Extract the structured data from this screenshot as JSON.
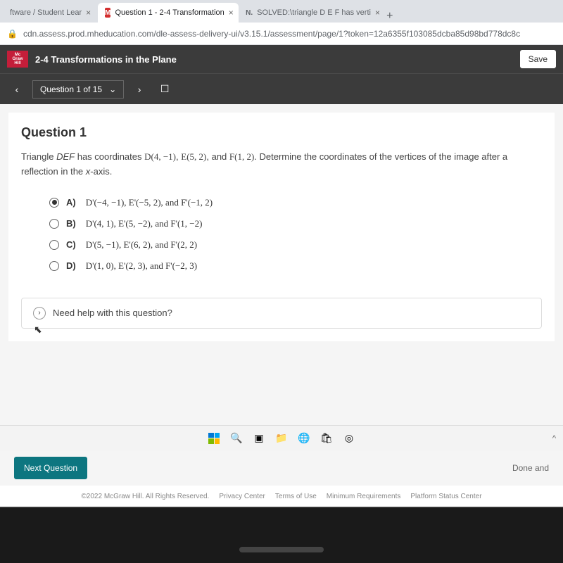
{
  "browser": {
    "tabs": [
      {
        "label": "ftware / Student Lear",
        "icon": ""
      },
      {
        "label": "Question 1 - 2-4 Transformation",
        "icon": "M"
      },
      {
        "label": "SOLVED:\\triangle D E F has verti",
        "icon": "N."
      }
    ],
    "url": "cdn.assess.prod.mheducation.com/dle-assess-delivery-ui/v3.15.1/assessment/page/1?token=12a6355f103085dcba85d98bd778dc8c"
  },
  "header": {
    "logo": "Mc Graw Hill",
    "title": "2-4 Transformations in the Plane",
    "save": "Save "
  },
  "nav": {
    "question_label": "Question 1 of 15"
  },
  "question": {
    "title": "Question 1",
    "stem_prefix": "Triangle ",
    "stem_triangle": "DEF",
    "stem_mid": " has coordinates ",
    "coordD": "D(4, −1)",
    "coordE": "E(5, 2)",
    "coordF": "F(1, 2)",
    "stem_suffix": ". Determine the coordinates of the vertices of the image after a reflection in the ",
    "stem_axis": "x",
    "stem_end": "-axis.",
    "choices": [
      {
        "key": "A)",
        "text": "D'(−4, −1),  E'(−5, 2), and F'(−1, 2)",
        "selected": true
      },
      {
        "key": "B)",
        "text": "D'(4, 1),  E'(5, −2), and F'(1, −2)",
        "selected": false
      },
      {
        "key": "C)",
        "text": "D'(5, −1),  E'(6, 2), and F'(2, 2)",
        "selected": false
      },
      {
        "key": "D)",
        "text": "D'(1, 0),  E'(2, 3), and F'(−2, 3)",
        "selected": false
      }
    ],
    "help": "Need help with this question?"
  },
  "actions": {
    "next": "Next Question",
    "done": "Done and "
  },
  "footer": {
    "copyright": "©2022 McGraw Hill. All Rights Reserved.",
    "links": [
      "Privacy Center",
      "Terms of Use",
      "Minimum Requirements",
      "Platform Status Center"
    ]
  }
}
